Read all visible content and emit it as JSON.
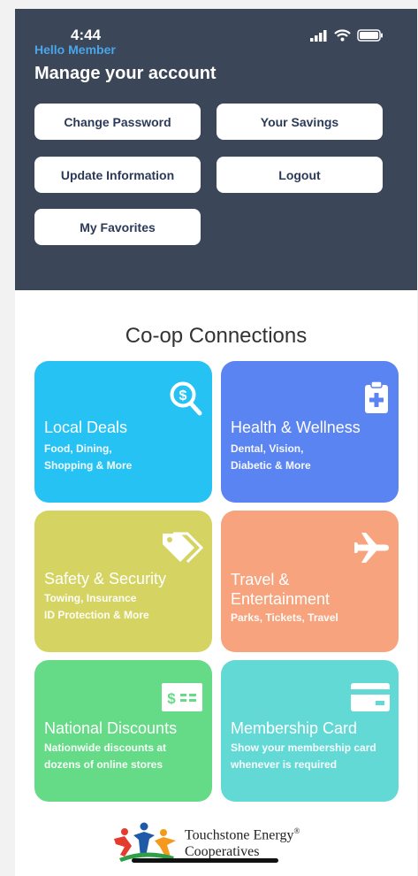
{
  "status": {
    "time": "4:44"
  },
  "header": {
    "greeting": "Hello Member",
    "title": "Manage your account",
    "buttons": {
      "change_password": "Change Password",
      "your_savings": "Your Savings",
      "update_information": "Update Information",
      "logout": "Logout",
      "my_favorites": "My Favorites"
    }
  },
  "section": {
    "title": "Co-op Connections"
  },
  "tiles": [
    {
      "title": "Local Deals",
      "sub1": "Food, Dining,",
      "sub2": "Shopping & More",
      "icon": "search-dollar-icon",
      "color": "#26c2f4"
    },
    {
      "title": "Health & Wellness",
      "sub1": "Dental, Vision,",
      "sub2": "Diabetic & More",
      "icon": "medical-clipboard-icon",
      "color": "#5b84f3"
    },
    {
      "title": "Safety & Security",
      "sub1": "Towing, Insurance",
      "sub2": "ID Protection & More",
      "icon": "tags-icon",
      "color": "#d5d462"
    },
    {
      "title": "Travel &",
      "title2": "Entertainment",
      "sub1": "Parks, Tickets, Travel",
      "icon": "airplane-icon",
      "color": "#f7a47e"
    },
    {
      "title": "National Discounts",
      "sub1": "Nationwide discounts at",
      "sub2": "dozens of online stores",
      "icon": "dollar-bill-icon",
      "color": "#65db87"
    },
    {
      "title": "Membership Card",
      "sub1": "Show your membership card",
      "sub2": "whenever is required",
      "icon": "card-icon",
      "color": "#63d9d6"
    }
  ],
  "footer": {
    "logo_line1": "Touchstone Energy",
    "logo_trademark": "®",
    "logo_line2": "Cooperatives"
  }
}
